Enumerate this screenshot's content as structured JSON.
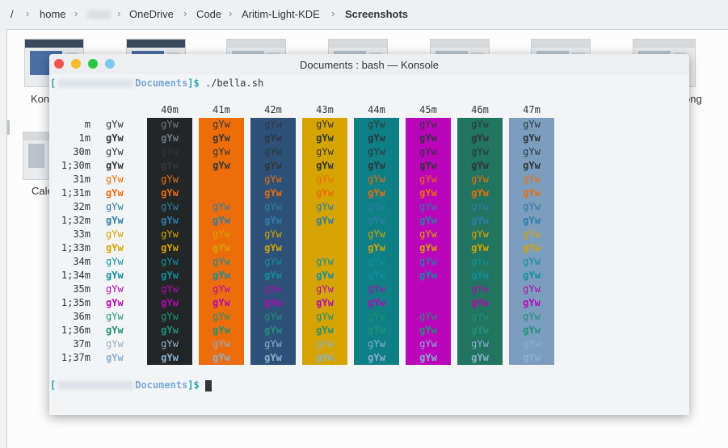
{
  "breadcrumb": {
    "root": "/",
    "items": [
      "home",
      "OneDrive",
      "Code",
      "Aritim-Light-KDE",
      "Screenshots"
    ]
  },
  "files": {
    "left_label_1": "Kon",
    "left_label_2": "Cale",
    "right_label": "ong"
  },
  "window": {
    "title": "Documents : bash — Konsole"
  },
  "terminal": {
    "dir": "Documents",
    "prompt_suffix": "]$",
    "command": "./bella.sh",
    "sample": "gYw",
    "headers": [
      "40m",
      "41m",
      "42m",
      "43m",
      "44m",
      "45m",
      "46m",
      "47m"
    ],
    "bg_colors": [
      "#232627",
      "#ed6d0b",
      "#2e5179",
      "#d5a402",
      "#0e7f85",
      "#ba05ba",
      "#207460",
      "#7b9ebe"
    ],
    "rows": [
      "m",
      "1m",
      "30m",
      "1;30m",
      "31m",
      "1;31m",
      "32m",
      "1;32m",
      "33m",
      "1;33m",
      "34m",
      "1;34m",
      "35m",
      "1;35m",
      "36m",
      "1;36m",
      "37m",
      "1;37m"
    ]
  },
  "colors": {
    "traffic": [
      "#f0554f",
      "#f5bd2e",
      "#27c840",
      "#7fc8ef"
    ],
    "fg": {
      "default": "#31363b",
      "black": "#31363b",
      "red": "#ed6d0b",
      "green": "#2a7ea8",
      "yellow": "#d5a402",
      "blue": "#0e8fa0",
      "magenta": "#b408b4",
      "cyan": "#219076",
      "white": "#8ab0cf"
    }
  }
}
